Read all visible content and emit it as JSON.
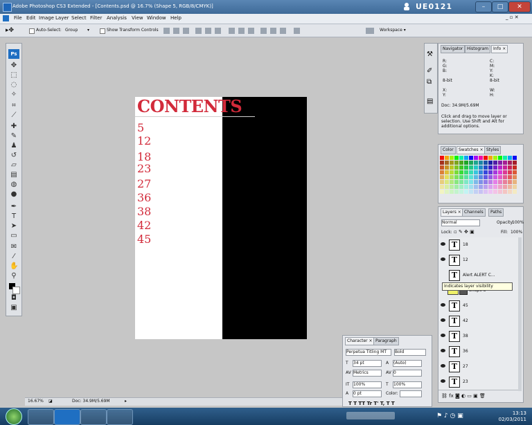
{
  "window": {
    "title": "Adobe Photoshop CS3 Extended - [Contents.psd @ 16.7% (Shape 5, RGB/8/CMYK)]",
    "user": "UE0121",
    "controls": [
      "–",
      "□",
      "✕"
    ]
  },
  "menu": [
    "File",
    "Edit",
    "Image",
    "Layer",
    "Select",
    "Filter",
    "Analysis",
    "View",
    "Window",
    "Help"
  ],
  "options": {
    "auto_select_label": "Auto-Select:",
    "auto_select_value": "Group",
    "show_transform_label": "Show Transform Controls",
    "workspace_label": "Workspace ▾"
  },
  "document": {
    "heading": "CONTENTS",
    "page_numbers": [
      "5",
      "12",
      "18",
      "23",
      "27",
      "36",
      "38",
      "42",
      "45"
    ]
  },
  "status": {
    "zoom": "16.67%",
    "doc_size": "Doc: 34.9M/5.69M"
  },
  "panels": {
    "nav_tabs": [
      "Navigator",
      "Histogram",
      "Info ×"
    ],
    "info": {
      "r": "R:",
      "g": "G:",
      "b": "B:",
      "c": "C:",
      "m": "M:",
      "y": "Y:",
      "k": "K:",
      "bit1": "8-bit",
      "bit2": "8-bit",
      "x": "X:",
      "yy": "Y:",
      "w": "W:",
      "h": "H:",
      "doc": "Doc: 34.9M/5.69M",
      "hint": "Click and drag to move layer or selection. Use Shift and Alt for additional options."
    },
    "color_tabs": [
      "Color",
      "Swatches ×",
      "Styles"
    ],
    "layers_tabs": [
      "Layers ×",
      "Channels",
      "Paths"
    ],
    "blend_mode": "Normal",
    "opacity_label": "Opacity:",
    "opacity_value": "100%",
    "lock_label": "Lock:",
    "fill_label": "Fill:",
    "fill_value": "100%",
    "layers": [
      "18",
      "12",
      "Alert  ALERT  C...",
      "Shape 3",
      "45",
      "42",
      "38",
      "36",
      "27",
      "23"
    ],
    "tooltip": "Indicates layer visibility",
    "character": {
      "tabs": [
        "Character ×",
        "Paragraph"
      ],
      "font": "Perpetua Titling MT",
      "style": "Bold",
      "size": "34 pt",
      "leading": "(Auto)",
      "kerning": "Metrics",
      "tracking": "0",
      "vscale": "100%",
      "hscale": "100%",
      "baseline": "0 pt",
      "color_label": "Color:",
      "type_buttons": "T T TT Tr T' T, T T"
    }
  },
  "taskbar": {
    "time": "13:13",
    "date": "02/03/2011"
  },
  "colors": {
    "accent_red": "#d22a3a",
    "titlebar": "#3e6a98",
    "taskbar": "#173d62"
  }
}
